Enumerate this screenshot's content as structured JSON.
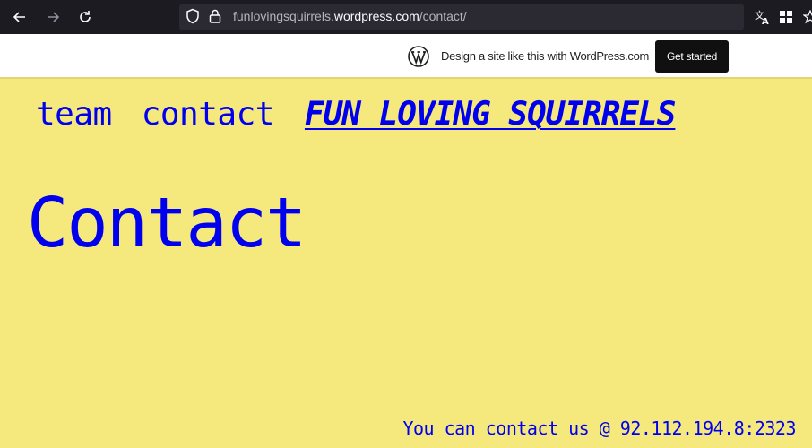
{
  "browser": {
    "url_host_prefix": "funlovingsquirrels.",
    "url_host_main": "wordpress.com",
    "url_path": "/contact/",
    "icons": [
      "back-arrow-icon",
      "forward-arrow-icon",
      "reload-icon",
      "shield-icon",
      "lock-icon",
      "translate-icon",
      "extensions-icon",
      "bookmark-star-icon"
    ]
  },
  "wp_banner": {
    "text": "Design a site like this with WordPress.com",
    "button_label": "Get started"
  },
  "nav": {
    "items": [
      {
        "label": "team"
      },
      {
        "label": "contact"
      }
    ],
    "site_title": "FUN LOVING SQUIRRELS"
  },
  "page": {
    "title": "Contact",
    "footer_note": "You can contact us @ 92.112.194.8:2323"
  },
  "colors": {
    "background": "#f5e97e",
    "link": "#0000ee",
    "toolbar": "#1c1b22"
  }
}
